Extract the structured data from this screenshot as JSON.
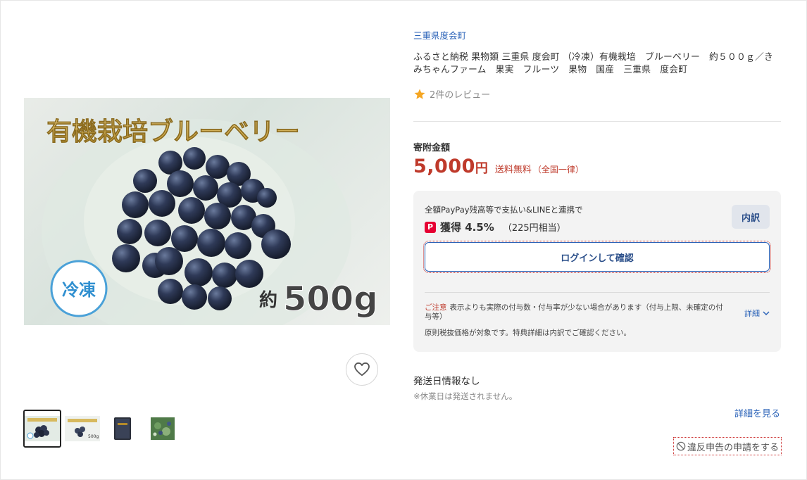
{
  "gallery": {
    "main_image": {
      "headline": "有機栽培ブルーベリー",
      "badge": "冷凍",
      "weight_prefix": "約",
      "weight": "500g"
    },
    "favorite_icon": "heart-outline-icon",
    "thumbnails": [
      {
        "label": "有機栽培ブルーベリー",
        "active": true
      },
      {
        "label": "有機栽培ブルーベリー 約500g",
        "active": false
      },
      {
        "label": "",
        "active": false
      },
      {
        "label": "",
        "active": false
      }
    ]
  },
  "product": {
    "seller": "三重県度会町",
    "title": "ふるさと納税 果物類 三重県 度会町 （冷凍）有機栽培　ブルーベリー　約５００ｇ／きみちゃんファーム　果実　フルーツ　果物　国産　三重県　度会町",
    "review_text": "2件のレビュー",
    "price_label": "寄附金額",
    "price_value": "5,000",
    "price_unit": "円",
    "shipping": "送料無料",
    "shipping_note": "（全国一律）"
  },
  "benefit": {
    "caption": "全額PayPay残高等で支払い&LINEと連携で",
    "icon_text": "P",
    "rate": "獲得 4.5%",
    "equiv": "（225円相当）",
    "breakdown_label": "内訳",
    "login_label": "ログインして確認",
    "caution_title": "ご注意",
    "caution_text": "表示よりも実際の付与数・付与率が少ない場合があります（付与上限、未確定の付与等）",
    "details_label": "詳細",
    "tax_note": "原則税抜価格が対象です。特典詳細は内訳でご確認ください。"
  },
  "shipping_info": {
    "date": "発送日情報なし",
    "note": "※休業日は発送されません。",
    "see_details": "詳細を見る"
  },
  "report": {
    "label": "違反申告の申請をする"
  },
  "colors": {
    "accent_red": "#bf3a2b",
    "link_blue": "#2b63b8",
    "star": "#f5a623",
    "paypay": "#e60033"
  }
}
